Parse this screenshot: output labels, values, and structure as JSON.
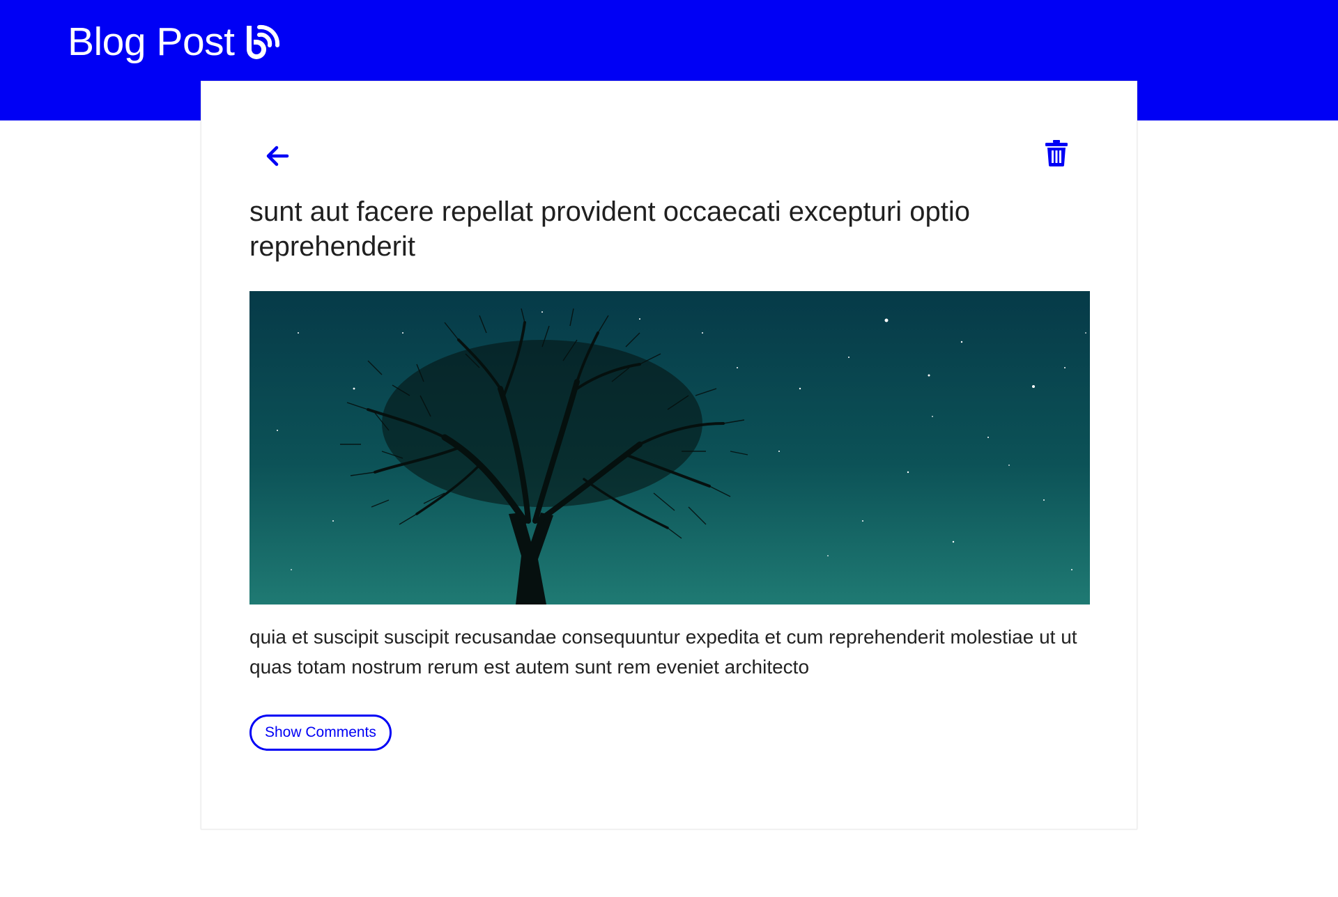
{
  "header": {
    "title": "Blog Post",
    "icon": "blogger-icon",
    "background_color": "#0000f5"
  },
  "post": {
    "back_icon": "arrow-left-icon",
    "delete_icon": "trash-icon",
    "title": "sunt aut facere repellat provident occaecati excepturi optio reprehenderit",
    "image_subject": "night-sky-tree",
    "body": "quia et suscipit suscipit recusandae consequuntur expedita et cum reprehenderit molestiae ut ut quas totam nostrum rerum est autem sunt rem eveniet architecto",
    "show_comments_label": "Show Comments",
    "accent_color": "#0000f5"
  }
}
